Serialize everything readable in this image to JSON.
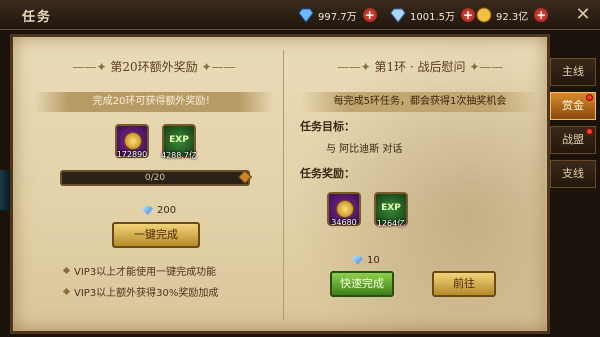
{
  "window": {
    "title": "任务"
  },
  "resources": [
    {
      "icon": "diamond-icon",
      "amount": "997.7万"
    },
    {
      "icon": "bound-diamond-icon",
      "amount": "1001.5万"
    },
    {
      "icon": "gold-coin-icon",
      "amount": "92.3亿"
    }
  ],
  "left": {
    "title": "第20环额外奖励",
    "banner": "完成20环可获得额外奖励！",
    "rewards": [
      {
        "icon": "gold-coin-icon",
        "amount": "172890"
      },
      {
        "icon": "exp-icon",
        "label": "EXP",
        "amount": "4288.7亿"
      }
    ],
    "progress": {
      "text": "0/20",
      "value": 0
    },
    "cost": "200",
    "button": "一键完成",
    "notes": [
      "VIP3以上才能使用一键完成功能",
      "VIP3以上额外获得30%奖励加成"
    ]
  },
  "right": {
    "title": "第1环 · 战后慰问",
    "banner": "每完成5环任务，都会获得1次抽奖机会",
    "objective_label": "任务目标：",
    "objective_text": "与 阿比迪斯 对话",
    "reward_label": "任务奖励：",
    "rewards": [
      {
        "icon": "gold-coin-icon",
        "amount": "34680"
      },
      {
        "icon": "exp-icon",
        "label": "EXP",
        "amount": "1264亿"
      }
    ],
    "cost": "10",
    "quick_button": "快速完成",
    "go_button": "前往"
  },
  "tabs": [
    {
      "label": "主线",
      "active": false,
      "badge": false
    },
    {
      "label": "赏金",
      "active": true,
      "badge": true
    },
    {
      "label": "战盟",
      "active": false,
      "badge": true
    },
    {
      "label": "支线",
      "active": false,
      "badge": false
    }
  ],
  "colors": {
    "accent": "#d88a2a",
    "badge": "#ff3a2a",
    "primary_button": "#f2d37a",
    "go_button": "#8ed04a"
  }
}
